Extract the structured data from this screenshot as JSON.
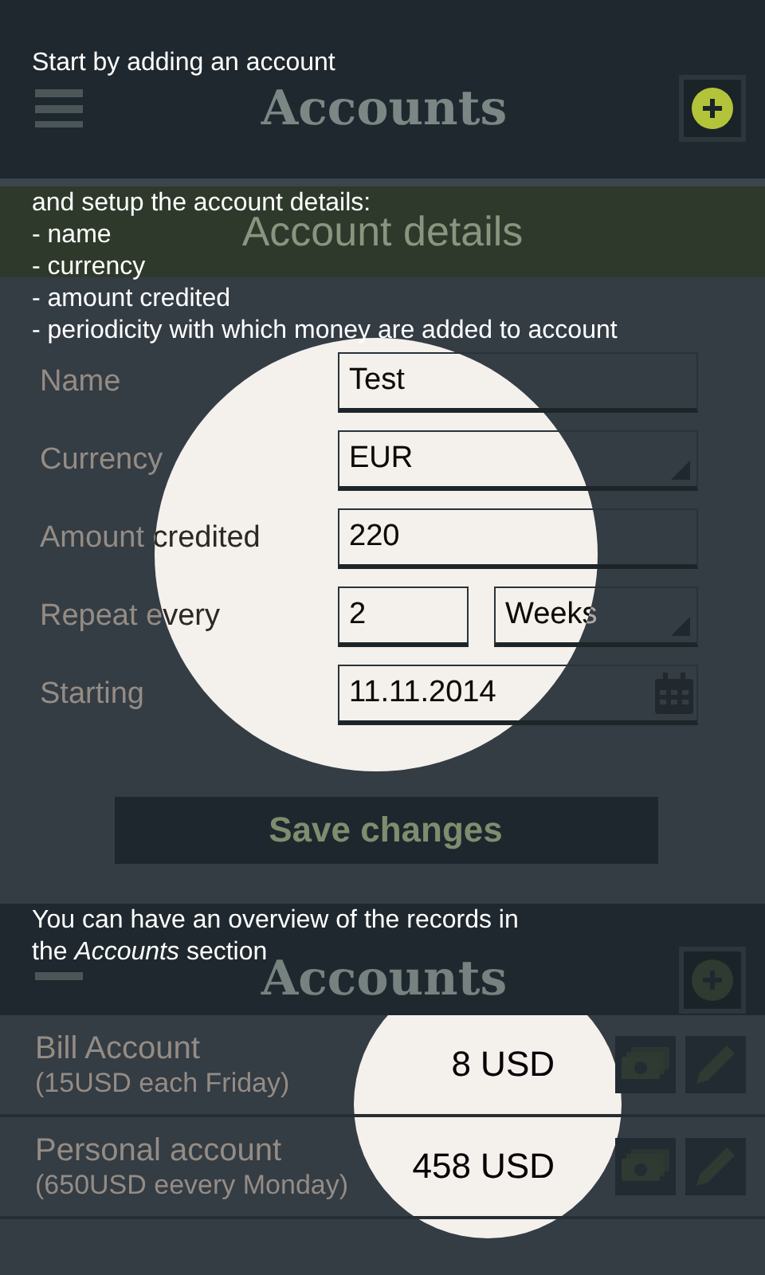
{
  "tutorial": [
    {
      "kind": "sentence",
      "text": "Start by adding an account"
    },
    {
      "kind": "lines",
      "lines": [
        "and setup the account details:",
        "- name",
        "- currency",
        "- amount credited",
        "- periodicity with which money are added to account"
      ]
    },
    {
      "kind": "sentence",
      "text": "You can have an overview of the records in the *Accounts* section"
    }
  ],
  "header": {
    "title": "Accounts",
    "add_spotlit": true
  },
  "form": {
    "title": "Account details",
    "fields": [
      {
        "label": "Name",
        "kind": "text",
        "value": "Test"
      },
      {
        "label": "Currency",
        "kind": "select",
        "value": "EUR"
      },
      {
        "label": "Amount credited",
        "kind": "text",
        "value": "220"
      },
      {
        "label": "Repeat every",
        "kind": "repeat",
        "value": "2",
        "unit": "Weeks"
      },
      {
        "label": "Starting",
        "kind": "date",
        "value": "11.11.2014"
      }
    ],
    "save_button": "Save changes"
  },
  "accounts": {
    "title": "Accounts",
    "add_spotlit": false,
    "rows": [
      {
        "name": "Bill Account",
        "detail": "(15USD each Friday)",
        "balance": "8 USD"
      },
      {
        "name": "Personal account",
        "detail": "(650USD eevery Monday)",
        "balance": "458 USD"
      }
    ]
  }
}
